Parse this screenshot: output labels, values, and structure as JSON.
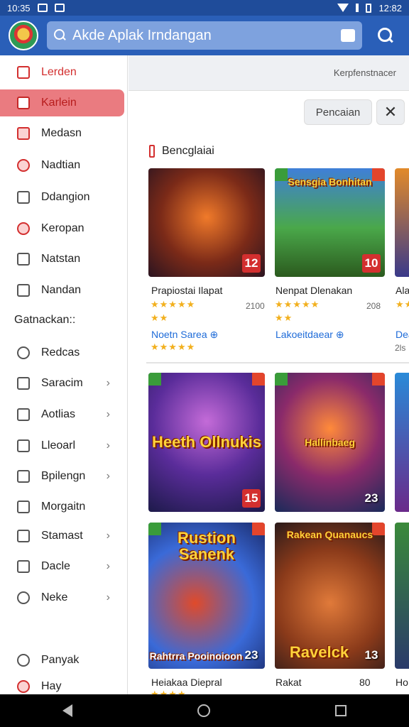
{
  "status": {
    "time": "10:35",
    "clock_right": "12:82"
  },
  "search": {
    "placeholder": "Akde Aplak Irndangan"
  },
  "sidebar": {
    "items": [
      {
        "label": "Lerden"
      },
      {
        "label": "Karlein"
      },
      {
        "label": "Medasn"
      },
      {
        "label": "Nadtian"
      },
      {
        "label": "Ddangion"
      },
      {
        "label": "Keropan"
      },
      {
        "label": "Natstan"
      },
      {
        "label": "Nandan"
      }
    ],
    "section_title": "Gatnackan::",
    "section_items": [
      {
        "label": "Redcas"
      },
      {
        "label": "Saracim"
      },
      {
        "label": "Aotlias"
      },
      {
        "label": "Lleoarl"
      },
      {
        "label": "Bpilengn"
      },
      {
        "label": "Morgaitn"
      },
      {
        "label": "Stamast"
      },
      {
        "label": "Dacle"
      },
      {
        "label": "Neke"
      }
    ],
    "bottom_item": {
      "label": "Panyak"
    },
    "partial_item": {
      "label": "Hay"
    }
  },
  "topstrip": {
    "text": "Kerpfenstnacer"
  },
  "filter": {
    "pill_label": "Pencaian",
    "close_label": "✕"
  },
  "section": {
    "title": "Bencglaiai"
  },
  "cards_row1": [
    {
      "art_title": "",
      "badge": "12",
      "name": "Prapiostai Ilapat",
      "stars": "★★★★★",
      "count": "2100",
      "stars2": "★★",
      "dev": "Noetn Sarea ⊕",
      "stars3": "★★★★★"
    },
    {
      "art_title": "Sensgia Bonhitan",
      "badge": "10",
      "name": "Nenpat Dlenakan",
      "stars": "★★★★★",
      "count": "208",
      "stars2": "★★",
      "dev": "Lakoeitdaear ⊕"
    },
    {
      "name": "Ala",
      "stars": "★★",
      "dev": "Dea",
      "count": "2ls"
    }
  ],
  "cards_row2": [
    {
      "art_title": "Heeth Ollnukis",
      "badge": "15"
    },
    {
      "art_title": "Hallinbaeg",
      "badge": "23"
    }
  ],
  "cards_row3": [
    {
      "art_title": "Rustion Sanenk",
      "sub_title": "Rahtrra Pooinoioon",
      "badge": "23",
      "name": "Heiakaa Diepral",
      "stars": "★★★★"
    },
    {
      "art_title": "Rakean Quanaucs",
      "sub_title": "Ravelck",
      "badge": "13",
      "name": "Rakat",
      "count": "80"
    },
    {
      "name": "Ho"
    }
  ]
}
